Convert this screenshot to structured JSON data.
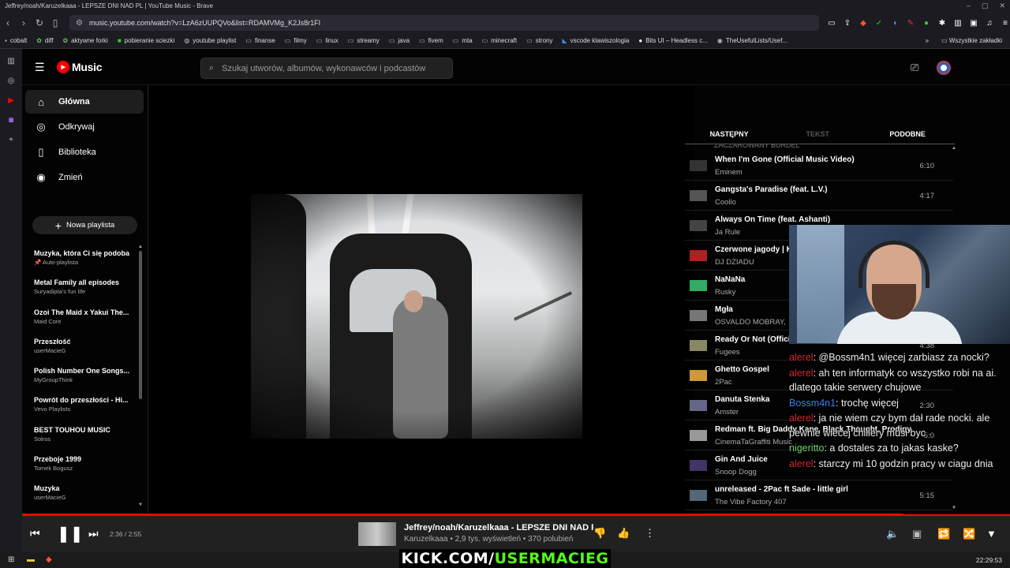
{
  "browser": {
    "window_title": "Jeffrey/noah/Karuzelkaaa - LEPSZE DNI NAD PL | YouTube Music - Brave",
    "url": "music.youtube.com/watch?v=LzA6zUUPQVo&list=RDAMVMg_K2Js8r1FI",
    "bookmarks": [
      "cobalt",
      "diff",
      "aktywne forki",
      "pobieranie sciezki",
      "youtube playlist",
      "finanse",
      "filmy",
      "linux",
      "streamy",
      "java",
      "fivem",
      "mta",
      "minecraft",
      "strony",
      "vscode klawiszologia",
      "Bits UI – Headless c...",
      "TheUsefulLists/Usef..."
    ],
    "bookmarks_overflow": "»",
    "all_bookmarks": "Wszystkie zakładki"
  },
  "app": {
    "logo_text": "Music",
    "search_placeholder": "Szukaj utworów, albumów, wykonawców i podcastów"
  },
  "sidebar": {
    "nav": [
      {
        "label": "Główna",
        "icon": "home-icon",
        "active": true
      },
      {
        "label": "Odkrywaj",
        "icon": "compass-icon",
        "active": false
      },
      {
        "label": "Biblioteka",
        "icon": "bookmark-icon",
        "active": false
      },
      {
        "label": "Zmień",
        "icon": "upgrade-icon",
        "active": false
      }
    ],
    "new_playlist": "Nowa playlista",
    "playlists": [
      {
        "title": "Muzyka, która Ci się podoba",
        "subtitle": "Auto-playlista"
      },
      {
        "title": "Metal Family all episodes",
        "subtitle": "Suryadipta's fun life"
      },
      {
        "title": "Ozoi The Maid x Yakui The...",
        "subtitle": "Maid Core"
      },
      {
        "title": "Przeszłość",
        "subtitle": "userMacieG"
      },
      {
        "title": "Polish Number One Songs...",
        "subtitle": "MyGroupThink"
      },
      {
        "title": "Powrót do przeszłości - Hi...",
        "subtitle": "Vevo Playlists"
      },
      {
        "title": "BEST TOUHOU MUSIC",
        "subtitle": "Solros"
      },
      {
        "title": "Przeboje 1999",
        "subtitle": "Tomek Bogusz"
      },
      {
        "title": "Muzyka",
        "subtitle": "userMacieG"
      }
    ]
  },
  "tabs": [
    "NASTĘPNY",
    "TEKST",
    "PODOBNE"
  ],
  "queue_top_partial": "ZACZAROWANY BURDEL",
  "queue": [
    {
      "title": "When I'm Gone (Official Music Video)",
      "artist": "Eminem",
      "duration": "6:10"
    },
    {
      "title": "Gangsta's Paradise (feat. L.V.)",
      "artist": "Coolio",
      "duration": "4:17"
    },
    {
      "title": "Always On Time (feat. Ashanti)",
      "artist": "Ja Rule",
      "duration": ""
    },
    {
      "title": "Czerwone jagody | K",
      "artist": "DJ DZIADU",
      "duration": ""
    },
    {
      "title": "NaNaNa",
      "artist": "Rusky",
      "duration": ""
    },
    {
      "title": "Mgła",
      "artist": "OSVALDO MOBRAY,",
      "duration": ""
    },
    {
      "title": "Ready Or Not (Official HD Video)",
      "artist": "Fugees",
      "duration": "4:38"
    },
    {
      "title": "Ghetto Gospel",
      "artist": "2Pac",
      "duration": ""
    },
    {
      "title": "Danuta Stenka",
      "artist": "Amster",
      "duration": "2:30"
    },
    {
      "title": "Redman ft. Big Daddy Kane, Black Thought, Prodigy",
      "artist": "CinemaTaGraffiti Music",
      "duration": "5:0"
    },
    {
      "title": "Gin And Juice",
      "artist": "Snoop Dogg",
      "duration": ""
    },
    {
      "title": "unreleased - 2Pac ft Sade - little girl",
      "artist": "The Vibe Factory 407",
      "duration": "5:15"
    }
  ],
  "chat": [
    {
      "user": "alerel",
      "text": ": @Bossm4n1 więcej zarbiasz za nocki?",
      "color": "red"
    },
    {
      "user": "alerel",
      "text": ": ah ten informatyk co wszystko robi na ai. dlatego takie serwery chujowe",
      "color": "red"
    },
    {
      "user": "Bossm4n1",
      "text": ": trochę więcej",
      "color": "blue"
    },
    {
      "user": "alerel",
      "text": ": ja nie wiem czy bym dał rade nocki. ale pewnie wiecej chillery musi byc",
      "color": "red"
    },
    {
      "user": "nigeritto",
      "text": ": a dostales za to jakas kaske?",
      "color": "green"
    },
    {
      "user": "alerel",
      "text": ": starczy mi 10 godzin pracy w ciagu dnia",
      "color": "red"
    }
  ],
  "player": {
    "time": "2:36 / 2:55",
    "progress": 0.892,
    "title": "Jeffrey/noah/Karuzelkaaa - LEPSZE DNI NAD PL",
    "subtitle": "Karuzelkaaa • 2,9 tys. wyświetleń • 370 polubień"
  },
  "overlay": {
    "kick_white": "KICK.COM/",
    "kick_green": "USERMACIEG"
  },
  "taskbar": {
    "clock": "22:29:53"
  },
  "colors": {
    "accent": "#ff0000",
    "kick_green": "#53fc18",
    "chat_red": "#d8262e",
    "chat_blue": "#3a83f1",
    "chat_green": "#6fd36f"
  }
}
